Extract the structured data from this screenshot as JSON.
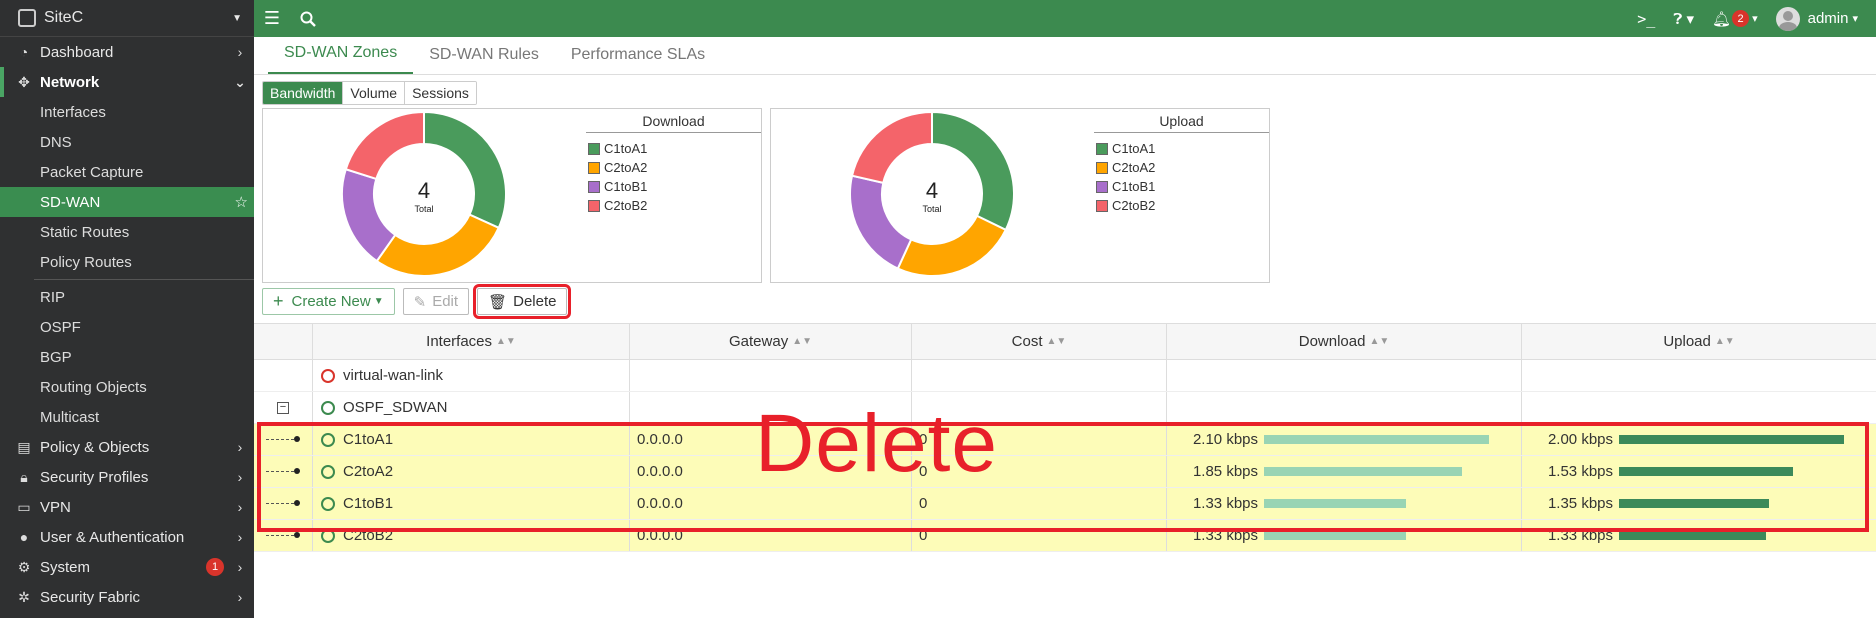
{
  "sidebar": {
    "site": "SiteC",
    "items": [
      {
        "label": "Dashboard",
        "icon": "dashboard-icon"
      },
      {
        "label": "Network",
        "icon": "network-icon"
      },
      {
        "label": "Interfaces"
      },
      {
        "label": "DNS"
      },
      {
        "label": "Packet Capture"
      },
      {
        "label": "SD-WAN"
      },
      {
        "label": "Static Routes"
      },
      {
        "label": "Policy Routes"
      },
      {
        "label": "RIP"
      },
      {
        "label": "OSPF"
      },
      {
        "label": "BGP"
      },
      {
        "label": "Routing Objects"
      },
      {
        "label": "Multicast"
      },
      {
        "label": "Policy & Objects",
        "icon": "policy-icon"
      },
      {
        "label": "Security Profiles",
        "icon": "lock-icon"
      },
      {
        "label": "VPN",
        "icon": "vpn-icon"
      },
      {
        "label": "User & Authentication",
        "icon": "user-icon"
      },
      {
        "label": "System",
        "icon": "gear-icon",
        "badge": "1"
      },
      {
        "label": "Security Fabric",
        "icon": "fabric-icon"
      }
    ]
  },
  "topbar": {
    "notifications": "2",
    "user": "admin"
  },
  "tabs": [
    "SD-WAN Zones",
    "SD-WAN Rules",
    "Performance SLAs"
  ],
  "segments": [
    "Bandwidth",
    "Volume",
    "Sessions"
  ],
  "charts": [
    {
      "title": "Download",
      "center_value": "4",
      "center_label": "Total"
    },
    {
      "title": "Upload",
      "center_value": "4",
      "center_label": "Total"
    }
  ],
  "chart_data": [
    {
      "type": "pie",
      "title": "Download",
      "categories": [
        "C1toA1",
        "C2toA2",
        "C1toB1",
        "C2toB2"
      ],
      "values": [
        2.1,
        1.85,
        1.33,
        1.33
      ],
      "colors": [
        "#4a9b5c",
        "#ffa500",
        "#a86fcb",
        "#f4646a"
      ]
    },
    {
      "type": "pie",
      "title": "Upload",
      "categories": [
        "C1toA1",
        "C2toA2",
        "C1toB1",
        "C2toB2"
      ],
      "values": [
        2.0,
        1.53,
        1.35,
        1.33
      ],
      "colors": [
        "#4a9b5c",
        "#ffa500",
        "#a86fcb",
        "#f4646a"
      ]
    }
  ],
  "toolbar": {
    "create": "Create New",
    "edit": "Edit",
    "delete": "Delete"
  },
  "table": {
    "headers": [
      "Interfaces",
      "Gateway",
      "Cost",
      "Download",
      "Upload"
    ],
    "groups": [
      {
        "name": "virtual-wan-link"
      },
      {
        "name": "OSPF_SDWAN"
      }
    ],
    "rows": [
      {
        "name": "C1toA1",
        "gateway": "0.0.0.0",
        "cost": "0",
        "download": "2.10 kbps",
        "dl_frac": 0.84,
        "upload": "2.00 kbps",
        "ul_frac": 0.84
      },
      {
        "name": "C2toA2",
        "gateway": "0.0.0.0",
        "cost": "0",
        "download": "1.85 kbps",
        "dl_frac": 0.74,
        "upload": "1.53 kbps",
        "ul_frac": 0.65
      },
      {
        "name": "C1toB1",
        "gateway": "0.0.0.0",
        "cost": "0",
        "download": "1.33 kbps",
        "dl_frac": 0.53,
        "upload": "1.35 kbps",
        "ul_frac": 0.56
      },
      {
        "name": "C2toB2",
        "gateway": "0.0.0.0",
        "cost": "0",
        "download": "1.33 kbps",
        "dl_frac": 0.53,
        "upload": "1.33 kbps",
        "ul_frac": 0.55
      }
    ]
  },
  "overlay_text": "Delete"
}
